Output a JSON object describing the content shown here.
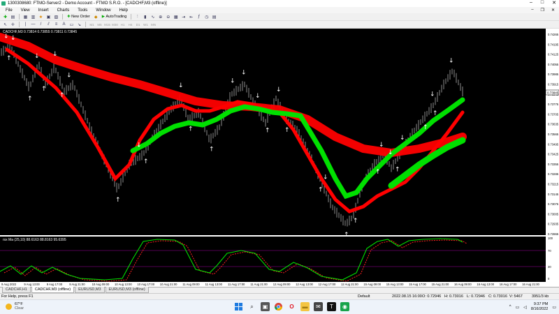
{
  "window": {
    "title": "1300308680: FTMO-Server2 - Demo Account - FTMO S.R.O. - [CADCHF,M3 (offline)]",
    "min_glyph": "–",
    "max_glyph": "□",
    "close_glyph": "✕"
  },
  "menu": {
    "items": [
      "File",
      "View",
      "Insert",
      "Charts",
      "Tools",
      "Window",
      "Help"
    ],
    "mdi_min": "–",
    "mdi_restore": "❐",
    "mdi_close": "✕"
  },
  "toolbar": {
    "new_order": "New Order",
    "autotrading": "AutoTrading"
  },
  "toolbar2": {
    "timeframes": [
      "M1",
      "M5",
      "M15",
      "M30",
      "H1",
      "H4",
      "D1",
      "W1",
      "MN"
    ]
  },
  "chart": {
    "symbol_line": "CADCHF,M3 0.73814 0.73855 0.73811 0.73845",
    "indicator_label": "rsx Ma (25,10) 88.6163 88.8163 95.6395",
    "price_labels": [
      "0.74265",
      "0.74195",
      "0.74125",
      "0.74055",
      "0.73985",
      "0.73915",
      "0.73845",
      "0.73775",
      "0.73705",
      "0.73635",
      "0.73565",
      "0.73495",
      "0.73425",
      "0.73355",
      "0.73285",
      "0.73215",
      "0.73145",
      "0.73075",
      "0.73005",
      "0.72935",
      "0.72865"
    ],
    "current_price": "0.73845",
    "sub_labels": [
      "100",
      "70",
      "30",
      "0"
    ],
    "time_labels": [
      "9 Aug 2022",
      "9 Aug 13:00",
      "9 Aug 17:00",
      "9 Aug 21:00",
      "10 Aug 09:00",
      "10 Aug 13:00",
      "10 Aug 17:00",
      "10 Aug 21:00",
      "11 Aug 09:00",
      "11 Aug 13:00",
      "11 Aug 17:00",
      "11 Aug 21:00",
      "12 Aug 09:00",
      "12 Aug 13:00",
      "12 Aug 17:00",
      "12 Aug 21:00",
      "15 Aug 09:00",
      "15 Aug 13:00",
      "15 Aug 17:00",
      "15 Aug 21:00",
      "16 Aug 09:00",
      "16 Aug 13:00",
      "16 Aug 17:00",
      "16 Aug 21:00"
    ],
    "colors": {
      "background": "#000000",
      "candles": "#8c8c8c",
      "slow_band": "#ff0000",
      "fast_band": "#00e000",
      "arrows": "#ffffff",
      "levels": "#a000a0"
    }
  },
  "tabs": [
    "CADCHF,H1",
    "CADCHF,M3 (offline)",
    "EURUSD,M3",
    "EURUSD,M3 (offline)"
  ],
  "status": {
    "help": "For Help, press F1",
    "profile": "Default",
    "datetime": "2022.08.15 16:00",
    "open": "O: 0.72946",
    "high": "H: 0.73016",
    "low": "L: 0.72946",
    "close": "C: 0.73016",
    "volume": "V: 5467",
    "traffic": "3951/3 kb"
  },
  "taskbar": {
    "temp": "67°F",
    "weather": "Clear",
    "time": "9:37 PM",
    "date": "8/16/2022"
  }
}
